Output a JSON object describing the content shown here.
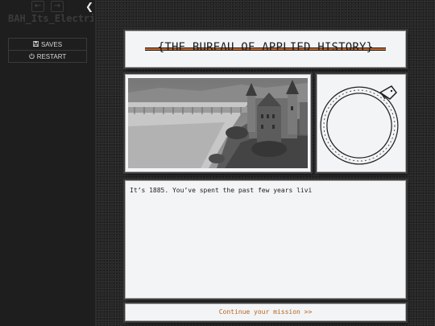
{
  "sidebar": {
    "back_icon": "arrow-left-icon",
    "forward_icon": "arrow-right-icon",
    "collapse_icon": "chevron-left-icon",
    "story_title": "BAH_Its_Electrif",
    "saves_label": "SAVES",
    "restart_label": "RESTART",
    "saves_icon": "floppy-disk-icon",
    "restart_icon": "power-icon"
  },
  "banner": {
    "title": "{THE BUREAU OF APPLIED HISTORY}",
    "stripe_color": "#c5672b"
  },
  "illustration": {
    "subject": "castle-by-river-with-bridge"
  },
  "emblem": {
    "subject": "ouroboros-icon"
  },
  "story": {
    "text": "It’s 1885. You’ve spent the past few years livi"
  },
  "continue": {
    "label": "Continue your mission >>",
    "color": "#b5651d"
  }
}
